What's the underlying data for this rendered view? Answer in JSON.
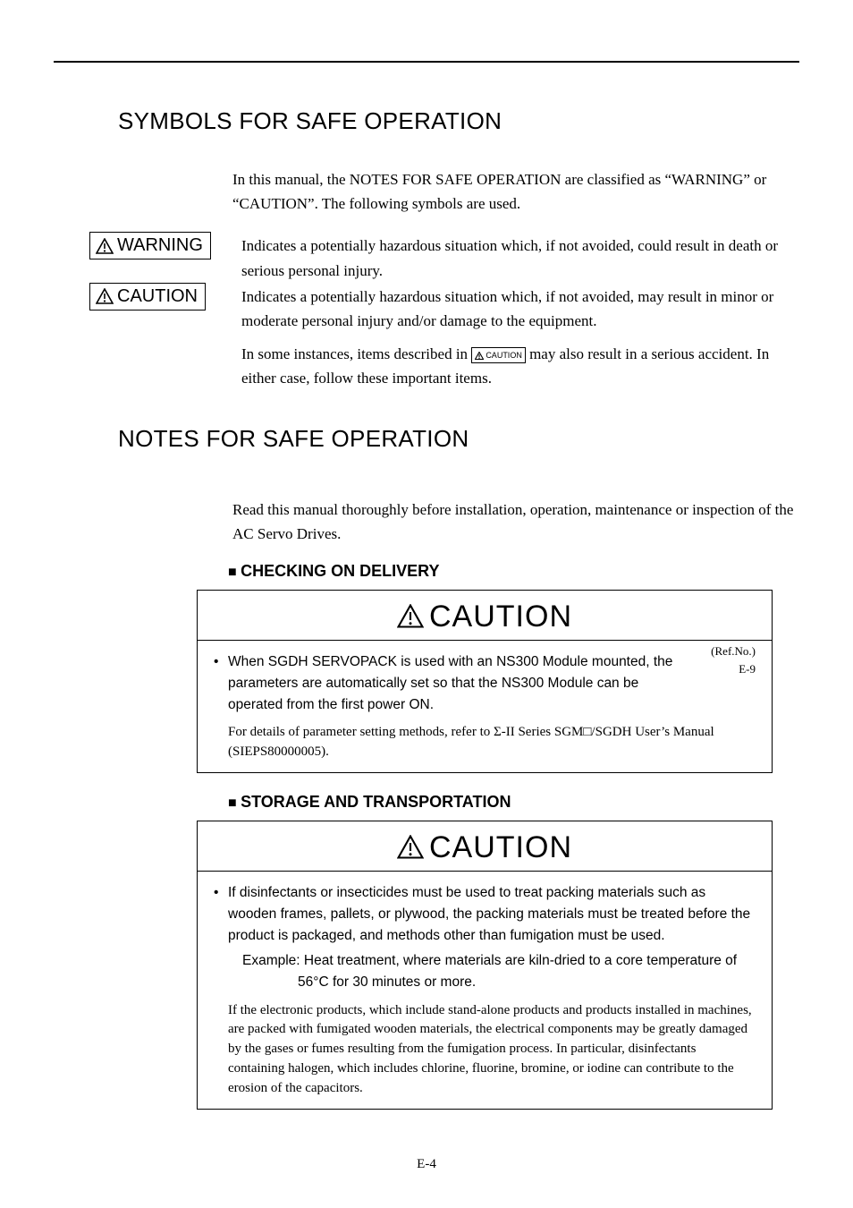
{
  "section1": {
    "title": "SYMBOLS FOR SAFE OPERATION",
    "intro": "In this manual, the NOTES FOR SAFE OPERATION are classified as “WARNING” or “CAUTION”.  The following symbols are used.",
    "warning_label": "WARNING",
    "warning_desc": "Indicates a potentially hazardous situation which, if not avoided, could result in death or serious personal injury.",
    "caution_label": "CAUTION",
    "caution_desc": "Indicates a potentially hazardous situation which, if not avoided, may  result in minor or moderate personal injury and/or damage to the equipment.",
    "badge_small": "CAUTION",
    "note_pre": "In some instances, items described in ",
    "note_post": "  may also result in a serious accident.  In either case, follow these important items."
  },
  "section2": {
    "title": "NOTES FOR SAFE OPERATION",
    "intro": "Read this manual thoroughly before installation, operation, maintenance or inspection of the AC Servo Drives.",
    "sub1": "CHECKING ON DELIVERY",
    "caution_hdr": "CAUTION",
    "ref_label": "(Ref.No.)",
    "ref_val": "E-9",
    "b1": "When SGDH SERVOPACK is used with an NS300 Module mounted, the parameters are automatically set so that the NS300 Module can be operated from the first power ON.",
    "b1_note": "For details of parameter setting methods, refer to Σ-II Series SGM□/SGDH User’s Manual (SIEPS80000005).",
    "sub2": "STORAGE AND TRANSPORTATION",
    "s2_b1": "If disinfectants or insecticides must be used to treat packing materials such as wooden frames, pallets, or plywood, the packing materials must be treated before the product is packaged, and methods other than fumigation must be used.",
    "s2_ex_line1": "Example: Heat treatment, where materials are kiln-dried to a core temperature of",
    "s2_ex_line2": "56°C for 30 minutes or more.",
    "s2_note": "If the electronic products, which include stand-alone products and products installed in machines, are packed with fumigated wooden materials, the electrical components may be greatly damaged by the gases or fumes resulting from the fumigation process. In particular, disinfectants containing halogen, which includes chlorine, fluorine, bromine, or iodine can contribute to the erosion of the capacitors."
  },
  "page_number": "E-4"
}
